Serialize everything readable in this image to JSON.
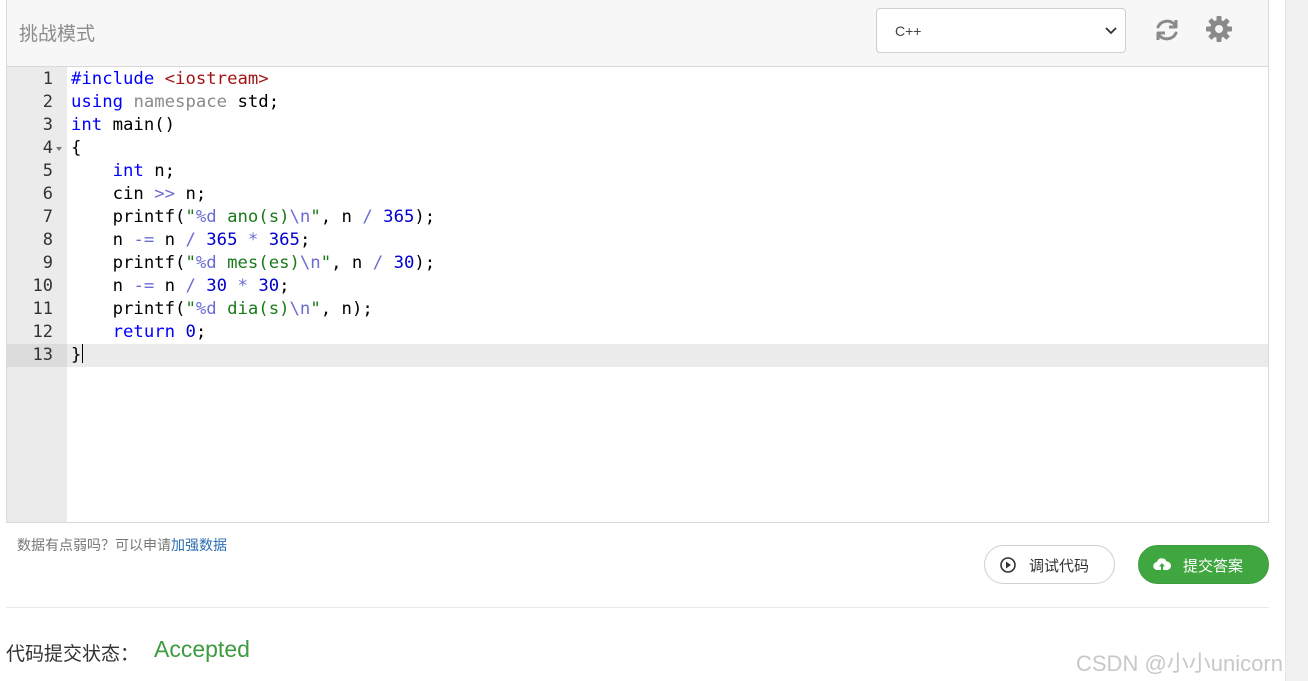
{
  "toolbar": {
    "mode_title": "挑战模式",
    "language": "C++",
    "refresh_icon": "refresh-icon",
    "settings_icon": "gear-icon"
  },
  "editor": {
    "line_numbers": [
      "1",
      "2",
      "3",
      "4",
      "5",
      "6",
      "7",
      "8",
      "9",
      "10",
      "11",
      "12",
      "13"
    ],
    "code_lines": [
      "#include <iostream>",
      "using namespace std;",
      "int main()",
      "{",
      "    int n;",
      "    cin >> n;",
      "    printf(\"%d ano(s)\\n\", n / 365);",
      "    n -= n / 365 * 365;",
      "    printf(\"%d mes(es)\\n\", n / 30);",
      "    n -= n / 30 * 30;",
      "    printf(\"%d dia(s)\\n\", n);",
      "    return 0;",
      "}"
    ],
    "active_line": 13
  },
  "footer": {
    "hint_text": "数据有点弱吗？可以申请",
    "hint_link": "加强数据",
    "debug_label": "调试代码",
    "submit_label": "提交答案",
    "status_label": "代码提交状态：",
    "status_value": "Accepted",
    "watermark": "CSDN @小小unicorn"
  },
  "colors": {
    "accepted": "#3f9b3f",
    "submit_bg": "#40a640",
    "link": "#2a6db0"
  }
}
